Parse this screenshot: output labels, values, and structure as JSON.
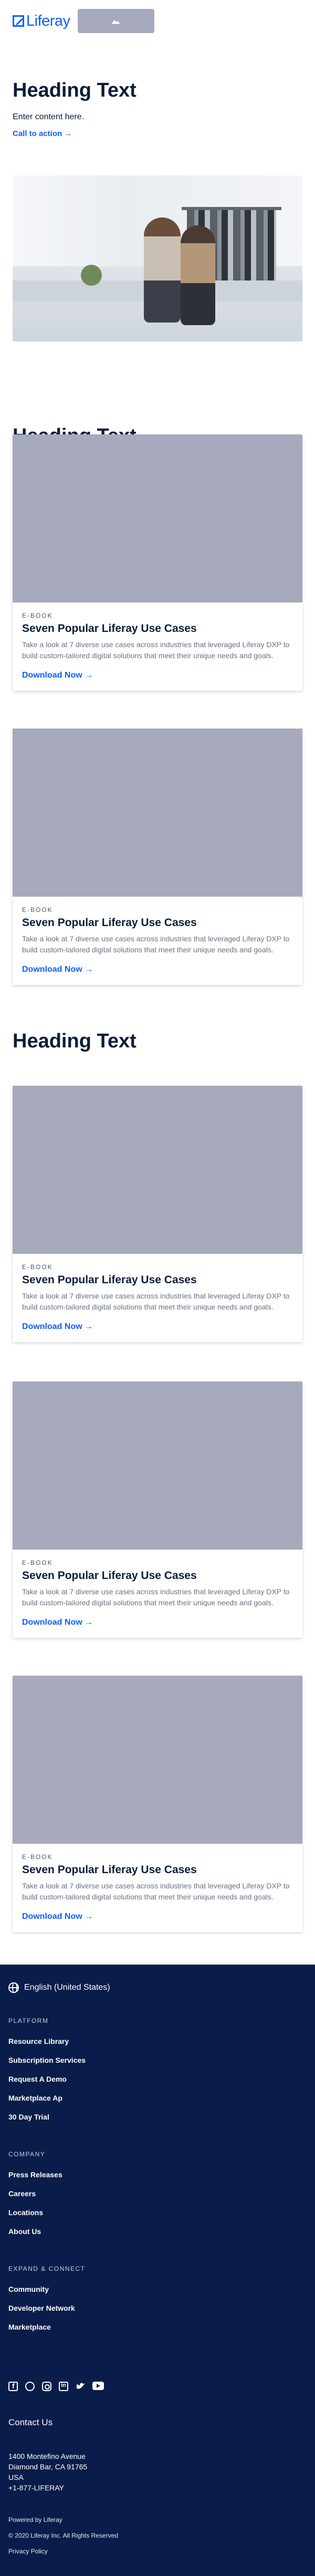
{
  "header": {
    "logo_text": "Liferay",
    "logo_icon": "liferay-logo-icon",
    "placeholder_icon": "image-icon"
  },
  "hero": {
    "heading": "Heading Text",
    "subtext": "Enter content here.",
    "cta_label": "Call to action →"
  },
  "sections": [
    {
      "heading": "Heading Text",
      "cards": [
        {
          "eyebrow": "E-BOOK",
          "title": "Seven Popular Liferay Use Cases",
          "text": "Take a look at 7 diverse use cases across industries that leveraged Liferay DXP to build custom-tailored digital solutions that meet their unique needs and goals.",
          "link": "Download Now →"
        },
        {
          "eyebrow": "E-BOOK",
          "title": "Seven Popular Liferay Use Cases",
          "text": "Take a look at 7 diverse use cases across industries that leveraged Liferay DXP to build custom-tailored digital solutions that meet their unique needs and goals.",
          "link": "Download Now →"
        }
      ]
    },
    {
      "heading": "Heading Text",
      "cards": [
        {
          "eyebrow": "E-BOOK",
          "title": "Seven Popular Liferay Use Cases",
          "text": "Take a look at 7 diverse use cases across industries that leveraged Liferay DXP to build custom-tailored digital solutions that meet their unique needs and goals.",
          "link": "Download Now →"
        },
        {
          "eyebrow": "E-BOOK",
          "title": "Seven Popular Liferay Use Cases",
          "text": "Take a look at 7 diverse use cases across industries that leveraged Liferay DXP to build custom-tailored digital solutions that meet their unique needs and goals.",
          "link": "Download Now →"
        },
        {
          "eyebrow": "E-BOOK",
          "title": "Seven Popular Liferay Use Cases",
          "text": "Take a look at 7 diverse use cases across industries that leveraged Liferay DXP to build custom-tailored digital solutions that meet their unique needs and goals.",
          "link": "Download Now →"
        }
      ]
    }
  ],
  "footer": {
    "language": "English (United States)",
    "groups": [
      {
        "heading": "PLATFORM",
        "items": [
          "Resource Library",
          "Subscription Services",
          "Request A Demo",
          "Marketplace Ap",
          "30 Day Trial"
        ]
      },
      {
        "heading": "COMPANY",
        "items": [
          "Press Releases",
          "Careers",
          "Locations",
          "About Us"
        ]
      },
      {
        "heading": "EXPAND & CONNECT",
        "items": [
          "Community",
          "Developer Network",
          "Marketplace"
        ]
      }
    ],
    "socials": [
      "facebook-icon",
      "github-icon",
      "instagram-icon",
      "linkedin-icon",
      "twitter-icon",
      "youtube-icon"
    ],
    "contact_heading": "Contact Us",
    "address": [
      "1400 Montefino Avenue",
      "Diamond Bar, CA 91765",
      "USA",
      "+1-877-LIFERAY"
    ],
    "powered_by": "Powered by Liferay",
    "copyright": "© 2020 Liferay Inc. All Rights Reserved",
    "privacy": "Privacy Policy"
  },
  "colors": {
    "brand_blue": "#0b5fff",
    "footer_bg": "#0a1c4a",
    "placeholder_gray": "#a7a9bc",
    "heading_text": "#0b1d3a"
  }
}
